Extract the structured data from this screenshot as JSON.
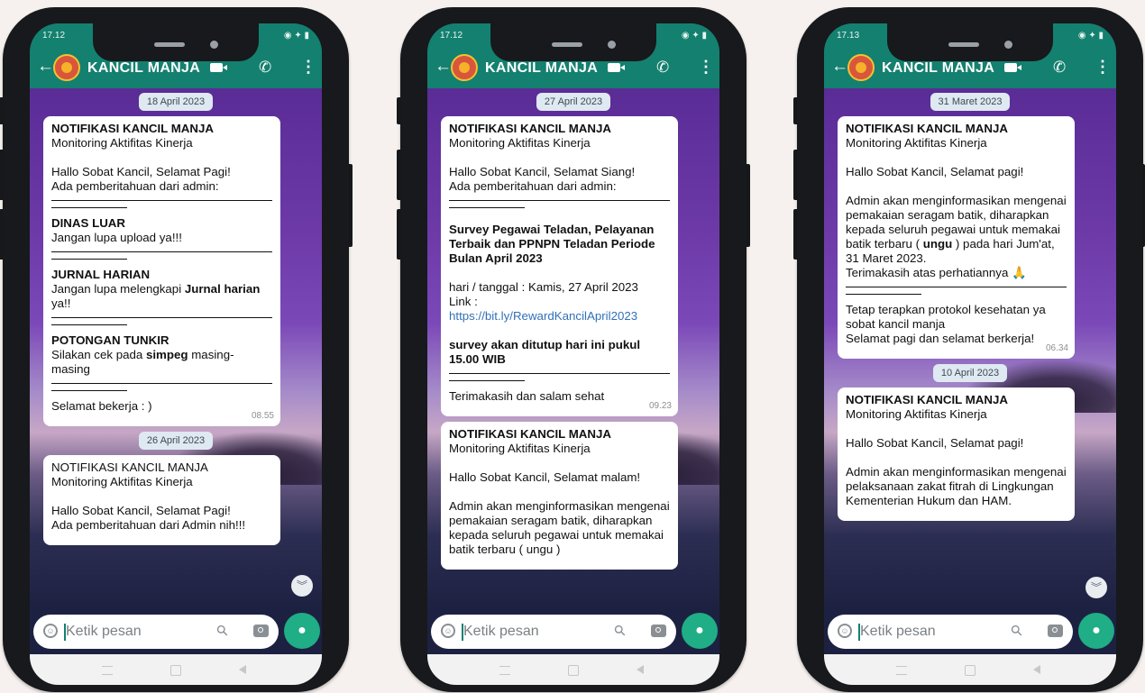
{
  "phones": [
    {
      "status_time": "17.12",
      "status_icons": "◉ ✦ ▮",
      "contact_name": "KANCIL MANJA",
      "input_placeholder": "Ketik pesan",
      "dates": [
        "18 April 2023",
        "26 April 2023"
      ],
      "msg1": {
        "title": "NOTIFIKASI KANCIL MANJA",
        "subtitle": "Monitoring Aktifitas Kinerja",
        "greeting": "Hallo Sobat Kancil, Selamat Pagi!",
        "intro": "Ada pemberitahuan dari admin:",
        "s1_head": "DINAS LUAR",
        "s1_text": "Jangan lupa upload ya!!!",
        "s2_head": "JURNAL HARIAN",
        "s2_pre": "Jangan lupa melengkapi ",
        "s2_bold": "Jurnal harian",
        "s2_post": " ya!!",
        "s3_head": "POTONGAN TUNKIR",
        "s3_pre": "Silakan cek pada ",
        "s3_bold": "simpeg",
        "s3_post": " masing-masing",
        "closing": "Selamat bekerja : )",
        "time": "08.55"
      },
      "msg2": {
        "title": "NOTIFIKASI KANCIL MANJA",
        "subtitle": "Monitoring Aktifitas Kinerja",
        "greeting": "Hallo Sobat Kancil, Selamat Pagi!",
        "intro": "Ada pemberitahuan dari Admin nih!!!"
      }
    },
    {
      "status_time": "17.12",
      "status_icons": "◉ ✦ ▮",
      "contact_name": "KANCIL MANJA",
      "input_placeholder": "Ketik pesan",
      "dates": [
        "27 April 2023"
      ],
      "msg1": {
        "title": "NOTIFIKASI KANCIL MANJA",
        "subtitle": "Monitoring Aktifitas Kinerja",
        "greeting": "Hallo Sobat Kancil, Selamat Siang!",
        "intro": "Ada pemberitahuan dari admin:",
        "headline": "Survey Pegawai Teladan, Pelayanan Terbaik dan PPNPN Teladan Periode Bulan April 2023",
        "date_line": "hari / tanggal :  Kamis, 27 April 2023",
        "link_label": "Link :",
        "link": "https://bit.ly/RewardKancilApril2023",
        "deadline": "survey akan ditutup hari ini pukul 15.00 WIB",
        "closing": "Terimakasih dan salam sehat",
        "time": "09.23"
      },
      "msg2": {
        "title": "NOTIFIKASI KANCIL MANJA",
        "subtitle": "Monitoring Aktifitas Kinerja",
        "greeting": "Hallo Sobat Kancil, Selamat malam!",
        "body": "Admin akan menginformasikan mengenai pemakaian seragam batik, diharapkan kepada seluruh pegawai untuk memakai batik terbaru ( ungu )"
      }
    },
    {
      "status_time": "17.13",
      "status_icons": "◉ ✦ ▮",
      "contact_name": "KANCIL MANJA",
      "input_placeholder": "Ketik pesan",
      "dates": [
        "31 Maret 2023",
        "10 April 2023"
      ],
      "msg1": {
        "title": "NOTIFIKASI KANCIL MANJA",
        "subtitle": "Monitoring Aktifitas Kinerja",
        "greeting": "Hallo Sobat Kancil, Selamat pagi!",
        "body_pre": "Admin akan menginformasikan mengenai pemakaian seragam batik, diharapkan kepada seluruh pegawai untuk memakai batik terbaru ( ",
        "body_bold": "ungu",
        "body_post": " ) pada hari Jum'at, 31 Maret 2023.",
        "thanks": "Terimakasih atas perhatiannya 🙏",
        "footer1": "Tetap terapkan protokol kesehatan ya sobat kancil manja",
        "footer2": "Selamat pagi dan selamat berkerja!",
        "time": "06.34"
      },
      "msg2": {
        "title": "NOTIFIKASI KANCIL MANJA",
        "subtitle": "Monitoring Aktifitas Kinerja",
        "greeting": "Hallo Sobat Kancil, Selamat pagi!",
        "body": "Admin akan menginformasikan mengenai pelaksanaan zakat fitrah di Lingkungan Kementerian Hukum dan HAM."
      }
    }
  ],
  "colors": {
    "header_green": "#14806f",
    "mic_green": "#1fae85",
    "phone_body": "#17191c",
    "page_background": "#f6f1ee"
  },
  "icons": [
    "back-arrow-icon",
    "avatar",
    "video-call-icon",
    "phone-call-icon",
    "more-options-icon",
    "emoji-icon",
    "attach-icon",
    "camera-icon",
    "mic-icon",
    "scroll-down-icon",
    "nav-menu-icon",
    "nav-home-icon",
    "nav-back-icon"
  ]
}
